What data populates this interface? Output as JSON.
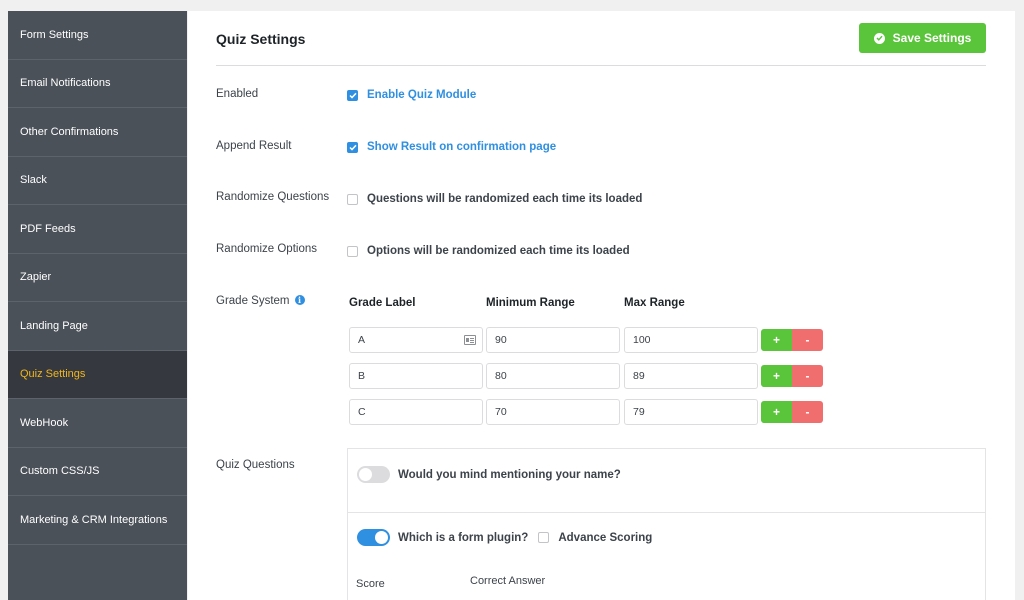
{
  "sidebar": {
    "items": [
      {
        "label": "Form Settings"
      },
      {
        "label": "Email Notifications"
      },
      {
        "label": "Other Confirmations"
      },
      {
        "label": "Slack"
      },
      {
        "label": "PDF Feeds"
      },
      {
        "label": "Zapier"
      },
      {
        "label": "Landing Page"
      },
      {
        "label": "Quiz Settings",
        "active": true
      },
      {
        "label": "WebHook"
      },
      {
        "label": "Custom CSS/JS"
      },
      {
        "label": "Marketing & CRM Integrations"
      }
    ]
  },
  "header": {
    "title": "Quiz Settings",
    "save_label": "Save Settings",
    "save_icon": "check-circle-icon"
  },
  "settings": {
    "enabled": {
      "label": "Enabled",
      "option": "Enable Quiz Module",
      "checked": true
    },
    "append_result": {
      "label": "Append Result",
      "option": "Show Result on confirmation page",
      "checked": true
    },
    "randomize_questions": {
      "label": "Randomize Questions",
      "option": "Questions will be randomized each time its loaded",
      "checked": false
    },
    "randomize_options": {
      "label": "Randomize Options",
      "option": "Options will be randomized each time its loaded",
      "checked": false
    }
  },
  "grade_system": {
    "label": "Grade System",
    "info_icon": "info-icon",
    "columns": [
      "Grade Label",
      "Minimum Range",
      "Max Range"
    ],
    "rows": [
      {
        "label": "A",
        "min": "90",
        "max": "100"
      },
      {
        "label": "B",
        "min": "80",
        "max": "89"
      },
      {
        "label": "C",
        "min": "70",
        "max": "79"
      }
    ],
    "plus": "+",
    "minus": "-"
  },
  "quiz_questions": {
    "label": "Quiz Questions",
    "questions": [
      {
        "text": "Would you mind mentioning your name?",
        "enabled": false
      },
      {
        "text": "Which is a form plugin?",
        "enabled": true,
        "advance_scoring_label": "Advance Scoring",
        "advance_scoring": false
      }
    ],
    "score_label": "Score",
    "correct_answer_label": "Correct Answer"
  },
  "colors": {
    "accent": "#2f8fe0",
    "success": "#5ac43a",
    "danger": "#f06e6e",
    "sidebar_bg": "#4b5159",
    "sidebar_active": "#f1b51c"
  }
}
